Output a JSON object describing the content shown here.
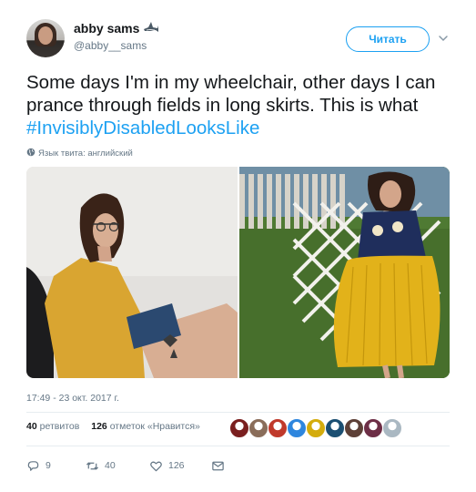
{
  "author": {
    "display_name": "abby sams",
    "username": "@abby__sams",
    "badge_icon": "shark-emoji-icon"
  },
  "follow_button": {
    "label": "Читать"
  },
  "tweet": {
    "text_before": "Some days I'm in my wheelchair, other days I can prance through fields in long skirts. This is what ",
    "hashtag": "#InvisiblyDisabledLooksLike",
    "language_note": "Язык твита: английский"
  },
  "media": {
    "photos": [
      "photo-woman-sitting-yellow-top",
      "photo-woman-yellow-skirt-lattice"
    ]
  },
  "timestamp": "17:49 - 23 окт. 2017 г.",
  "stats": {
    "retweets_count": "40",
    "retweets_label": "ретвитов",
    "likes_count": "126",
    "likes_label": "отметок «Нравится»"
  },
  "likers": {
    "colors": [
      "#7a1f1f",
      "#8a6d5a",
      "#c0392b",
      "#2e86de",
      "#d4ac0d",
      "#1b4f72",
      "#5d4037",
      "#6d2e46",
      "#aab8c2"
    ]
  },
  "actions": {
    "reply_count": "9",
    "retweet_count": "40",
    "like_count": "126"
  },
  "colors": {
    "accent": "#1da1f2",
    "text": "#14171a",
    "muted": "#657786",
    "divider": "#e6ecf0"
  }
}
